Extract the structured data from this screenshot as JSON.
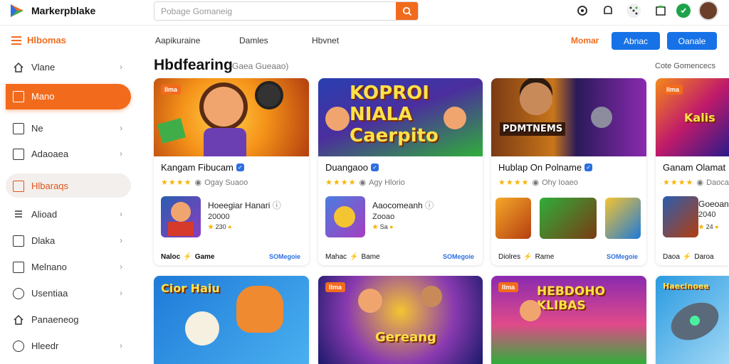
{
  "topbar": {
    "brand": "Markerpblake",
    "search_placeholder": "Pobage Gomaneig"
  },
  "sidebar": {
    "header": "Hlbomas",
    "items": [
      {
        "label": "Vlane"
      },
      {
        "label": "Mano"
      },
      {
        "label": "Ne"
      },
      {
        "label": "Adaoaea"
      },
      {
        "label": "Hlbaraqs"
      },
      {
        "label": "Alioad"
      },
      {
        "label": "Dlaka"
      },
      {
        "label": "Melnano"
      },
      {
        "label": "Usentiaa"
      },
      {
        "label": "Panaeneog"
      },
      {
        "label": "Hleedr"
      }
    ]
  },
  "subnav": {
    "items": [
      "Aapikuraine",
      "Damles",
      "Hbvnet"
    ],
    "action_label": "Momar",
    "btn1": "Abnac",
    "btn2": "Oanale"
  },
  "section": {
    "title": "Hbdfearing",
    "subtitle": "Gaea Gueaao)",
    "right_link": "Cote Gomencecs"
  },
  "cards": [
    {
      "badge": "Ilma",
      "name": "Kangam Fibucam",
      "rating_text": "Ogay Suaoo",
      "game_name": "Hoeegiar Hanari",
      "game_sub": "20000",
      "points": "230",
      "footer": "Naloc",
      "footer2": "Game",
      "link": "SOMegoie"
    },
    {
      "badge": "",
      "overlay": "KOPROI NIALA Caerpito",
      "name": "Duangaoo",
      "rating_text": "Agy Hlorio",
      "game_name": "Aaocomeanh",
      "game_sub": "Zooao",
      "points": "Sa",
      "footer": "Mahac",
      "footer2": "Bame",
      "link": "SOMegoie"
    },
    {
      "badge": "",
      "overlay": "PDMTNEMS",
      "name": "Hublap On Polname",
      "rating_text": "Ohy Ioaeo",
      "footer": "Diolres",
      "footer2": "Rame",
      "link": "SOMegoie"
    },
    {
      "badge": "Ilma",
      "overlay": "Kalis",
      "name": "Ganam Olamat",
      "rating_text": "Daoca",
      "game_name": "Goeoan",
      "game_sub": "2040",
      "points": "24",
      "footer": "Daoa",
      "footer2": "Daroa",
      "link": ""
    }
  ],
  "row2": [
    {
      "overlay": "Cior Haiu",
      "badge": ""
    },
    {
      "overlay": "Gereang",
      "badge": "Ilma"
    },
    {
      "overlay": "HEBDOHO KLIBAS",
      "badge": "Ilma"
    },
    {
      "overlay": "Haecinoee",
      "badge": ""
    }
  ],
  "colors": {
    "accent": "#f26b1d",
    "primary_button": "#1672e6",
    "star": "#f5b50a"
  }
}
